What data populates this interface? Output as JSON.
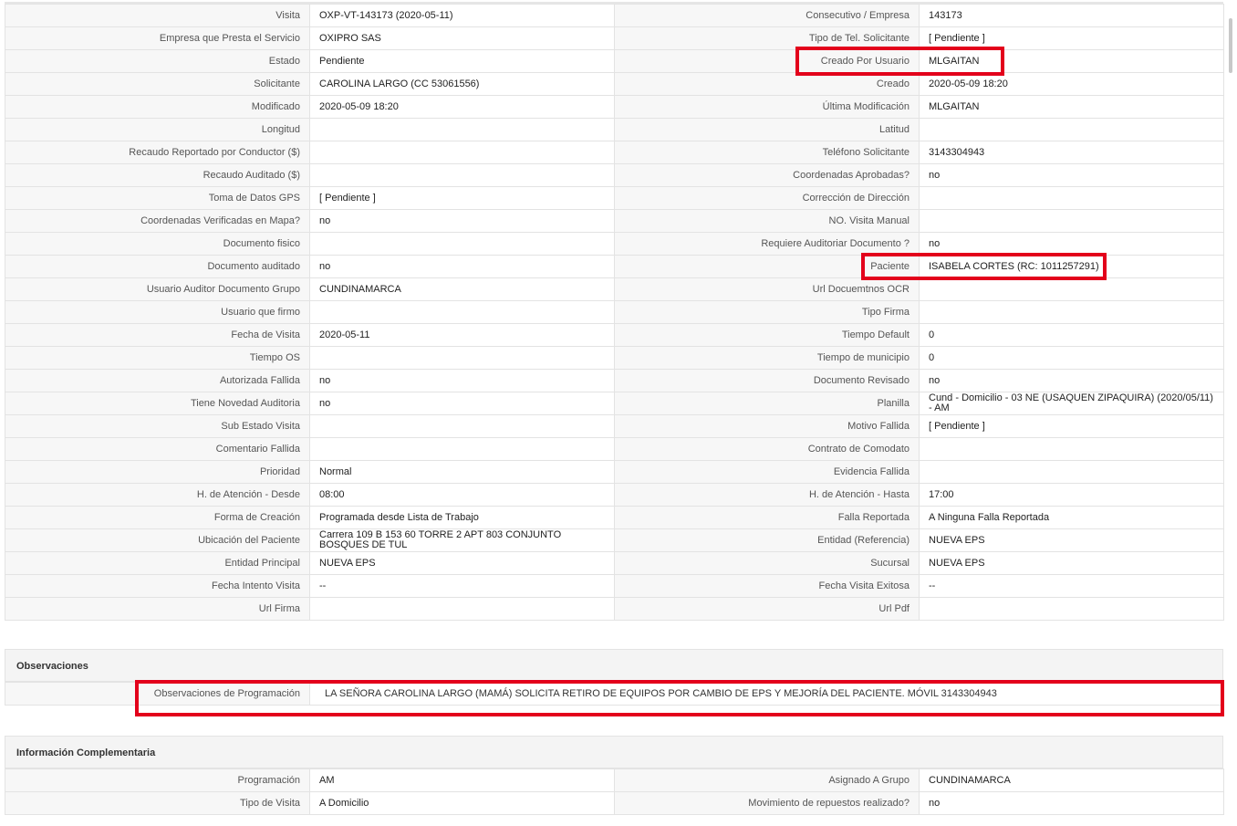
{
  "main_rows": [
    {
      "l1": "Visita",
      "v1": "OXP-VT-143173 (2020-05-11)",
      "l2": "Consecutivo / Empresa",
      "v2": "143173"
    },
    {
      "l1": "Empresa que Presta el Servicio",
      "v1": "OXIPRO SAS",
      "l2": "Tipo de Tel. Solicitante",
      "v2": "[ Pendiente ]"
    },
    {
      "l1": "Estado",
      "v1": "Pendiente",
      "l2": "Creado Por Usuario",
      "v2": "MLGAITAN"
    },
    {
      "l1": "Solicitante",
      "v1": "CAROLINA LARGO (CC 53061556)",
      "l2": "Creado",
      "v2": "2020-05-09 18:20"
    },
    {
      "l1": "Modificado",
      "v1": "2020-05-09 18:20",
      "l2": "Última Modificación",
      "v2": " MLGAITAN"
    },
    {
      "l1": "Longitud",
      "v1": "",
      "l2": "Latitud",
      "v2": ""
    },
    {
      "l1": "Recaudo Reportado por Conductor ($)",
      "v1": "",
      "l2": "Teléfono Solicitante",
      "v2": "3143304943"
    },
    {
      "l1": "Recaudo Auditado ($)",
      "v1": "",
      "l2": "Coordenadas Aprobadas?",
      "v2": " no"
    },
    {
      "l1": "Toma de Datos GPS",
      "v1": "[ Pendiente ]",
      "l2": "Corrección de Dirección",
      "v2": ""
    },
    {
      "l1": "Coordenadas Verificadas en Mapa?",
      "v1": " no",
      "l2": "NO. Visita Manual",
      "v2": ""
    },
    {
      "l1": "Documento fisico",
      "v1": "",
      "l2": "Requiere Auditoriar Documento ?",
      "v2": " no"
    },
    {
      "l1": "Documento auditado",
      "v1": " no",
      "l2": "Paciente",
      "v2": "ISABELA CORTES (RC: 1011257291)"
    },
    {
      "l1": "Usuario Auditor Documento Grupo",
      "v1": "CUNDINAMARCA",
      "l2": "Url Docuemtnos OCR",
      "v2": ""
    },
    {
      "l1": "Usuario que firmo",
      "v1": "",
      "l2": "Tipo Firma",
      "v2": ""
    },
    {
      "l1": "Fecha de Visita",
      "v1": " 2020-05-11",
      "l2": "Tiempo Default",
      "v2": "0"
    },
    {
      "l1": "Tiempo OS",
      "v1": "",
      "l2": "Tiempo de municipio",
      "v2": "0"
    },
    {
      "l1": "Autorizada Fallida",
      "v1": " no",
      "l2": "Documento Revisado",
      "v2": " no"
    },
    {
      "l1": "Tiene Novedad Auditoria",
      "v1": " no",
      "l2": "Planilla",
      "v2": "Cund - Domicilio - 03 NE (USAQUEN ZIPAQUIRA) (2020/05/11) - AM"
    },
    {
      "l1": "Sub Estado Visita",
      "v1": "",
      "l2": "Motivo Fallida",
      "v2": "[ Pendiente ]"
    },
    {
      "l1": "Comentario Fallida",
      "v1": "",
      "l2": "Contrato de Comodato",
      "v2": ""
    },
    {
      "l1": "Prioridad",
      "v1": "Normal",
      "l2": "Evidencia Fallida",
      "v2": ""
    },
    {
      "l1": "H. de Atención - Desde",
      "v1": "08:00",
      "l2": "H. de Atención - Hasta",
      "v2": "17:00"
    },
    {
      "l1": "Forma de Creación",
      "v1": "Programada desde Lista de Trabajo",
      "l2": "Falla Reportada",
      "v2": "A Ninguna Falla Reportada"
    },
    {
      "l1": "Ubicación del Paciente",
      "v1": "Carrera 109 B 153 60 TORRE 2 APT 803 CONJUNTO BOSQUES DE TUL",
      "l2": "Entidad (Referencia)",
      "v2": "NUEVA EPS"
    },
    {
      "l1": "Entidad Principal",
      "v1": "NUEVA EPS",
      "l2": "Sucursal",
      "v2": "NUEVA EPS"
    },
    {
      "l1": "Fecha Intento Visita",
      "v1": " --",
      "l2": "Fecha Visita Exitosa",
      "v2": " --"
    },
    {
      "l1": "Url Firma",
      "v1": "",
      "l2": "Url Pdf",
      "v2": ""
    }
  ],
  "observaciones": {
    "title": "Observaciones",
    "label": "Observaciones de Programación",
    "value": "LA SEÑORA CAROLINA LARGO (MAMÁ) SOLICITA RETIRO DE EQUIPOS POR CAMBIO DE EPS Y MEJORÍA DEL PACIENTE. MÓVIL 3143304943"
  },
  "complementaria": {
    "title": "Información Complementaria",
    "rows": [
      {
        "l1": "Programación",
        "v1": "AM",
        "l2": "Asignado A Grupo",
        "v2": "CUNDINAMARCA"
      },
      {
        "l1": "Tipo de Visita",
        "v1": "A Domicilio",
        "l2": "Movimiento de repuestos realizado?",
        "v2": " no"
      }
    ]
  },
  "colors": {
    "highlight": "#e3001b",
    "label_bg": "#f7f7f7",
    "border": "#e3e3e3"
  }
}
